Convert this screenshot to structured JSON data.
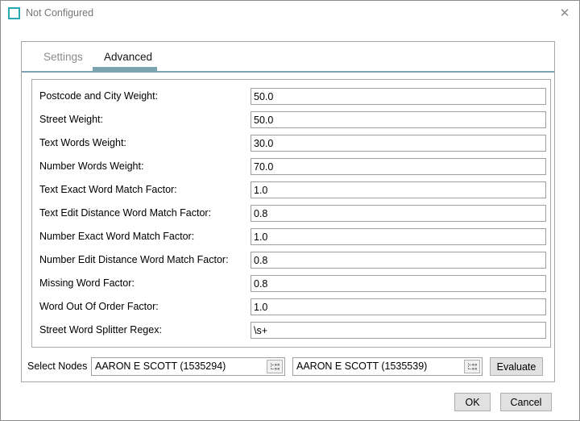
{
  "window": {
    "title": "Not Configured",
    "close_glyph": "✕"
  },
  "tabs": {
    "settings": {
      "label": "Settings",
      "active": false
    },
    "advanced": {
      "label": "Advanced",
      "active": true
    }
  },
  "form": {
    "fields": [
      {
        "label": "Postcode and City Weight:",
        "value": "50.0"
      },
      {
        "label": "Street Weight:",
        "value": "50.0"
      },
      {
        "label": "Text Words Weight:",
        "value": "30.0"
      },
      {
        "label": "Number Words Weight:",
        "value": "70.0"
      },
      {
        "label": "Text Exact Word Match Factor:",
        "value": "1.0"
      },
      {
        "label": "Text Edit Distance Word Match Factor:",
        "value": "0.8"
      },
      {
        "label": "Number Exact Word Match Factor:",
        "value": "1.0"
      },
      {
        "label": "Number Edit Distance Word Match Factor:",
        "value": "0.8"
      },
      {
        "label": "Missing Word Factor:",
        "value": "0.8"
      },
      {
        "label": "Word Out Of Order Factor:",
        "value": "1.0"
      },
      {
        "label": "Street Word Splitter Regex:",
        "value": "\\s+"
      }
    ]
  },
  "node_selector": {
    "label": "Select Nodes",
    "node1": "AARON E SCOTT (1535294)",
    "node2": "AARON E SCOTT (1535539)",
    "evaluate_label": "Evaluate"
  },
  "footer": {
    "ok_label": "OK",
    "cancel_label": "Cancel"
  },
  "colors": {
    "accent": "#7ca3b2",
    "title_icon_teal": "#2aa7b4"
  }
}
